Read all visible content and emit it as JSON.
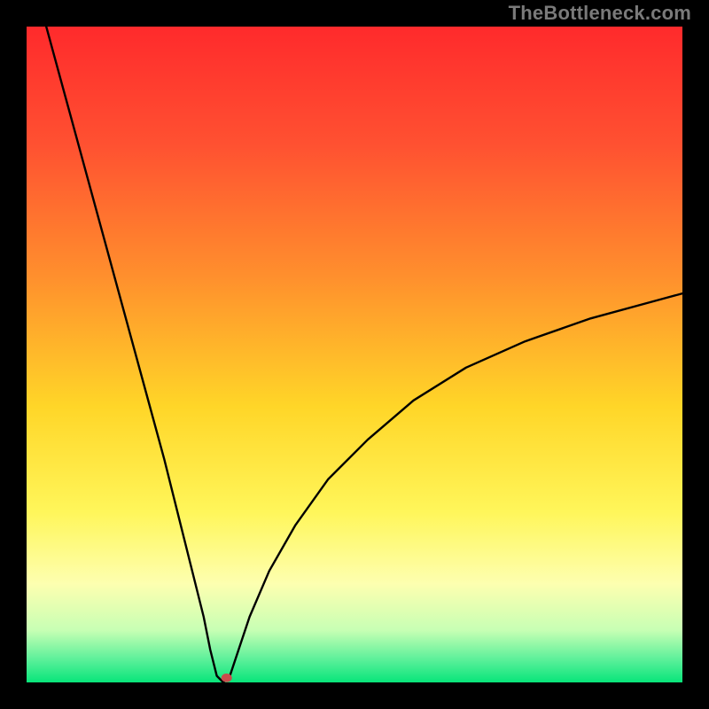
{
  "watermark": "TheBottleneck.com",
  "chart_data": {
    "type": "line",
    "title": "",
    "xlabel": "",
    "ylabel": "",
    "xlim": [
      0,
      100
    ],
    "ylim": [
      0,
      100
    ],
    "grid": false,
    "legend": false,
    "curve_description": "V-shaped curve: steep linear drop from top-left to a minimum near x≈30, then concave rise toward right edge reaching ~y≈60 at x=100",
    "series": [
      {
        "name": "curve",
        "x": [
          3,
          6,
          9,
          12,
          15,
          18,
          21,
          24,
          27,
          28,
          29,
          30,
          31,
          32,
          34,
          37,
          41,
          46,
          52,
          59,
          67,
          76,
          86,
          97,
          100
        ],
        "y": [
          100,
          89,
          78,
          67,
          56,
          45,
          34,
          22,
          10,
          5,
          1,
          0,
          1,
          4,
          10,
          17,
          24,
          31,
          37,
          43,
          48,
          52,
          55.5,
          58.5,
          59.3
        ]
      }
    ],
    "marker": {
      "x": 30.5,
      "y": 0.7,
      "color": "#c94b4b",
      "r": 6
    },
    "gradient_stops": [
      {
        "offset": 0.0,
        "color": "#ff2a2c"
      },
      {
        "offset": 0.18,
        "color": "#ff5131"
      },
      {
        "offset": 0.38,
        "color": "#ff8f2d"
      },
      {
        "offset": 0.58,
        "color": "#ffd628"
      },
      {
        "offset": 0.74,
        "color": "#fff65a"
      },
      {
        "offset": 0.85,
        "color": "#fdffb0"
      },
      {
        "offset": 0.92,
        "color": "#c8ffb4"
      },
      {
        "offset": 0.965,
        "color": "#5cf09a"
      },
      {
        "offset": 1.0,
        "color": "#08e57a"
      }
    ],
    "curve_color": "#000000",
    "curve_width": 2.4
  }
}
